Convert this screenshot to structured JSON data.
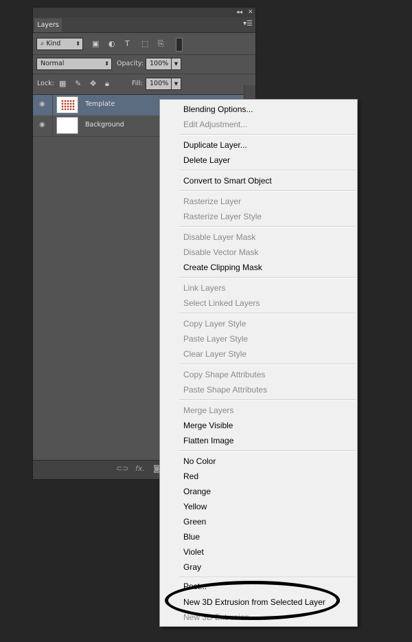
{
  "panel": {
    "tab_label": "Layers",
    "panel_menu_icon": "panel-menu-icon",
    "filter_kind": "Kind",
    "blend_mode": "Normal",
    "opacity_label": "Opacity:",
    "opacity_value": "100%",
    "lock_label": "Lock:",
    "fill_label": "Fill:",
    "fill_value": "100%",
    "layers": [
      {
        "name": "Template",
        "selected": true
      },
      {
        "name": "Background",
        "selected": false
      }
    ],
    "bottom_icons": [
      "link-icon",
      "fx-icon",
      "mask-icon"
    ]
  },
  "context_menu": {
    "items": [
      {
        "label": "Blending Options...",
        "enabled": true
      },
      {
        "label": "Edit Adjustment...",
        "enabled": false
      },
      {
        "label": "Duplicate Layer...",
        "enabled": true
      },
      {
        "label": "Delete Layer",
        "enabled": true
      },
      {
        "label": "Convert to Smart Object",
        "enabled": true
      },
      {
        "label": "Rasterize Layer",
        "enabled": false
      },
      {
        "label": "Rasterize Layer Style",
        "enabled": false
      },
      {
        "label": "Disable Layer Mask",
        "enabled": false
      },
      {
        "label": "Disable Vector Mask",
        "enabled": false
      },
      {
        "label": "Create Clipping Mask",
        "enabled": true
      },
      {
        "label": "Link Layers",
        "enabled": false
      },
      {
        "label": "Select Linked Layers",
        "enabled": false
      },
      {
        "label": "Copy Layer Style",
        "enabled": false
      },
      {
        "label": "Paste Layer Style",
        "enabled": false
      },
      {
        "label": "Clear Layer Style",
        "enabled": false
      },
      {
        "label": "Copy Shape Attributes",
        "enabled": false
      },
      {
        "label": "Paste Shape Attributes",
        "enabled": false
      },
      {
        "label": "Merge Layers",
        "enabled": false
      },
      {
        "label": "Merge Visible",
        "enabled": true
      },
      {
        "label": "Flatten Image",
        "enabled": true
      },
      {
        "label": "No Color",
        "enabled": true
      },
      {
        "label": "Red",
        "enabled": true
      },
      {
        "label": "Orange",
        "enabled": true
      },
      {
        "label": "Yellow",
        "enabled": true
      },
      {
        "label": "Green",
        "enabled": true
      },
      {
        "label": "Blue",
        "enabled": true
      },
      {
        "label": "Violet",
        "enabled": true
      },
      {
        "label": "Gray",
        "enabled": true
      },
      {
        "label": "Post...",
        "enabled": true
      },
      {
        "label": "New 3D Extrusion from Selected Layer",
        "enabled": true
      },
      {
        "label": "New 3D Extrusion...",
        "enabled": false
      }
    ]
  },
  "colors": {
    "panel_bg": "#535353",
    "selected_layer": "#5b6b80",
    "menu_bg": "#f0f0f0",
    "annotation": "#000000"
  }
}
